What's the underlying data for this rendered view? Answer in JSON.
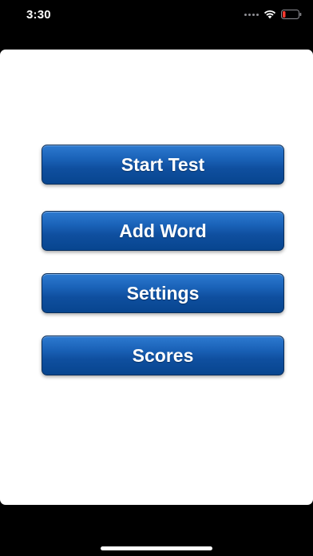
{
  "status_bar": {
    "time": "3:30",
    "icons": [
      "signal-dots-icon",
      "wifi-icon",
      "battery-low-icon"
    ],
    "battery_color": "#ff3b30"
  },
  "menu": {
    "start_test_label": "Start Test",
    "add_word_label": "Add Word",
    "settings_label": "Settings",
    "scores_label": "Scores"
  },
  "colors": {
    "button_gradient_top": "#2d7ad0",
    "button_gradient_bottom": "#07458f",
    "background": "#000000",
    "card": "#ffffff"
  }
}
